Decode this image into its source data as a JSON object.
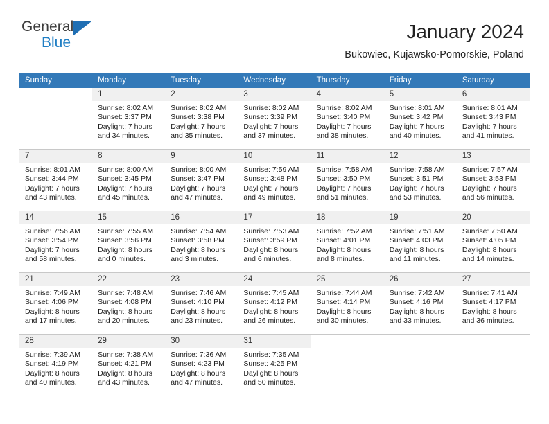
{
  "brand": {
    "name_part1": "General",
    "name_part2": "Blue",
    "triangle_icon": "triangle-icon",
    "color_dark": "#3c3c3c",
    "color_blue": "#1f7ec4"
  },
  "header": {
    "title": "January 2024",
    "location": "Bukowiec, Kujawsko-Pomorskie, Poland",
    "header_bg": "#3379b8",
    "daynum_bg": "#f0f0f0"
  },
  "calendar": {
    "weekday_headers": [
      "Sunday",
      "Monday",
      "Tuesday",
      "Wednesday",
      "Thursday",
      "Friday",
      "Saturday"
    ],
    "weeks": [
      [
        {
          "day": "",
          "blank": true
        },
        {
          "day": "1",
          "sunrise": "Sunrise: 8:02 AM",
          "sunset": "Sunset: 3:37 PM",
          "daylight1": "Daylight: 7 hours",
          "daylight2": "and 34 minutes."
        },
        {
          "day": "2",
          "sunrise": "Sunrise: 8:02 AM",
          "sunset": "Sunset: 3:38 PM",
          "daylight1": "Daylight: 7 hours",
          "daylight2": "and 35 minutes."
        },
        {
          "day": "3",
          "sunrise": "Sunrise: 8:02 AM",
          "sunset": "Sunset: 3:39 PM",
          "daylight1": "Daylight: 7 hours",
          "daylight2": "and 37 minutes."
        },
        {
          "day": "4",
          "sunrise": "Sunrise: 8:02 AM",
          "sunset": "Sunset: 3:40 PM",
          "daylight1": "Daylight: 7 hours",
          "daylight2": "and 38 minutes."
        },
        {
          "day": "5",
          "sunrise": "Sunrise: 8:01 AM",
          "sunset": "Sunset: 3:42 PM",
          "daylight1": "Daylight: 7 hours",
          "daylight2": "and 40 minutes."
        },
        {
          "day": "6",
          "sunrise": "Sunrise: 8:01 AM",
          "sunset": "Sunset: 3:43 PM",
          "daylight1": "Daylight: 7 hours",
          "daylight2": "and 41 minutes."
        }
      ],
      [
        {
          "day": "7",
          "sunrise": "Sunrise: 8:01 AM",
          "sunset": "Sunset: 3:44 PM",
          "daylight1": "Daylight: 7 hours",
          "daylight2": "and 43 minutes."
        },
        {
          "day": "8",
          "sunrise": "Sunrise: 8:00 AM",
          "sunset": "Sunset: 3:45 PM",
          "daylight1": "Daylight: 7 hours",
          "daylight2": "and 45 minutes."
        },
        {
          "day": "9",
          "sunrise": "Sunrise: 8:00 AM",
          "sunset": "Sunset: 3:47 PM",
          "daylight1": "Daylight: 7 hours",
          "daylight2": "and 47 minutes."
        },
        {
          "day": "10",
          "sunrise": "Sunrise: 7:59 AM",
          "sunset": "Sunset: 3:48 PM",
          "daylight1": "Daylight: 7 hours",
          "daylight2": "and 49 minutes."
        },
        {
          "day": "11",
          "sunrise": "Sunrise: 7:58 AM",
          "sunset": "Sunset: 3:50 PM",
          "daylight1": "Daylight: 7 hours",
          "daylight2": "and 51 minutes."
        },
        {
          "day": "12",
          "sunrise": "Sunrise: 7:58 AM",
          "sunset": "Sunset: 3:51 PM",
          "daylight1": "Daylight: 7 hours",
          "daylight2": "and 53 minutes."
        },
        {
          "day": "13",
          "sunrise": "Sunrise: 7:57 AM",
          "sunset": "Sunset: 3:53 PM",
          "daylight1": "Daylight: 7 hours",
          "daylight2": "and 56 minutes."
        }
      ],
      [
        {
          "day": "14",
          "sunrise": "Sunrise: 7:56 AM",
          "sunset": "Sunset: 3:54 PM",
          "daylight1": "Daylight: 7 hours",
          "daylight2": "and 58 minutes."
        },
        {
          "day": "15",
          "sunrise": "Sunrise: 7:55 AM",
          "sunset": "Sunset: 3:56 PM",
          "daylight1": "Daylight: 8 hours",
          "daylight2": "and 0 minutes."
        },
        {
          "day": "16",
          "sunrise": "Sunrise: 7:54 AM",
          "sunset": "Sunset: 3:58 PM",
          "daylight1": "Daylight: 8 hours",
          "daylight2": "and 3 minutes."
        },
        {
          "day": "17",
          "sunrise": "Sunrise: 7:53 AM",
          "sunset": "Sunset: 3:59 PM",
          "daylight1": "Daylight: 8 hours",
          "daylight2": "and 6 minutes."
        },
        {
          "day": "18",
          "sunrise": "Sunrise: 7:52 AM",
          "sunset": "Sunset: 4:01 PM",
          "daylight1": "Daylight: 8 hours",
          "daylight2": "and 8 minutes."
        },
        {
          "day": "19",
          "sunrise": "Sunrise: 7:51 AM",
          "sunset": "Sunset: 4:03 PM",
          "daylight1": "Daylight: 8 hours",
          "daylight2": "and 11 minutes."
        },
        {
          "day": "20",
          "sunrise": "Sunrise: 7:50 AM",
          "sunset": "Sunset: 4:05 PM",
          "daylight1": "Daylight: 8 hours",
          "daylight2": "and 14 minutes."
        }
      ],
      [
        {
          "day": "21",
          "sunrise": "Sunrise: 7:49 AM",
          "sunset": "Sunset: 4:06 PM",
          "daylight1": "Daylight: 8 hours",
          "daylight2": "and 17 minutes."
        },
        {
          "day": "22",
          "sunrise": "Sunrise: 7:48 AM",
          "sunset": "Sunset: 4:08 PM",
          "daylight1": "Daylight: 8 hours",
          "daylight2": "and 20 minutes."
        },
        {
          "day": "23",
          "sunrise": "Sunrise: 7:46 AM",
          "sunset": "Sunset: 4:10 PM",
          "daylight1": "Daylight: 8 hours",
          "daylight2": "and 23 minutes."
        },
        {
          "day": "24",
          "sunrise": "Sunrise: 7:45 AM",
          "sunset": "Sunset: 4:12 PM",
          "daylight1": "Daylight: 8 hours",
          "daylight2": "and 26 minutes."
        },
        {
          "day": "25",
          "sunrise": "Sunrise: 7:44 AM",
          "sunset": "Sunset: 4:14 PM",
          "daylight1": "Daylight: 8 hours",
          "daylight2": "and 30 minutes."
        },
        {
          "day": "26",
          "sunrise": "Sunrise: 7:42 AM",
          "sunset": "Sunset: 4:16 PM",
          "daylight1": "Daylight: 8 hours",
          "daylight2": "and 33 minutes."
        },
        {
          "day": "27",
          "sunrise": "Sunrise: 7:41 AM",
          "sunset": "Sunset: 4:17 PM",
          "daylight1": "Daylight: 8 hours",
          "daylight2": "and 36 minutes."
        }
      ],
      [
        {
          "day": "28",
          "sunrise": "Sunrise: 7:39 AM",
          "sunset": "Sunset: 4:19 PM",
          "daylight1": "Daylight: 8 hours",
          "daylight2": "and 40 minutes."
        },
        {
          "day": "29",
          "sunrise": "Sunrise: 7:38 AM",
          "sunset": "Sunset: 4:21 PM",
          "daylight1": "Daylight: 8 hours",
          "daylight2": "and 43 minutes."
        },
        {
          "day": "30",
          "sunrise": "Sunrise: 7:36 AM",
          "sunset": "Sunset: 4:23 PM",
          "daylight1": "Daylight: 8 hours",
          "daylight2": "and 47 minutes."
        },
        {
          "day": "31",
          "sunrise": "Sunrise: 7:35 AM",
          "sunset": "Sunset: 4:25 PM",
          "daylight1": "Daylight: 8 hours",
          "daylight2": "and 50 minutes."
        },
        {
          "day": "",
          "blank": true
        },
        {
          "day": "",
          "blank": true
        },
        {
          "day": "",
          "blank": true
        }
      ]
    ]
  }
}
